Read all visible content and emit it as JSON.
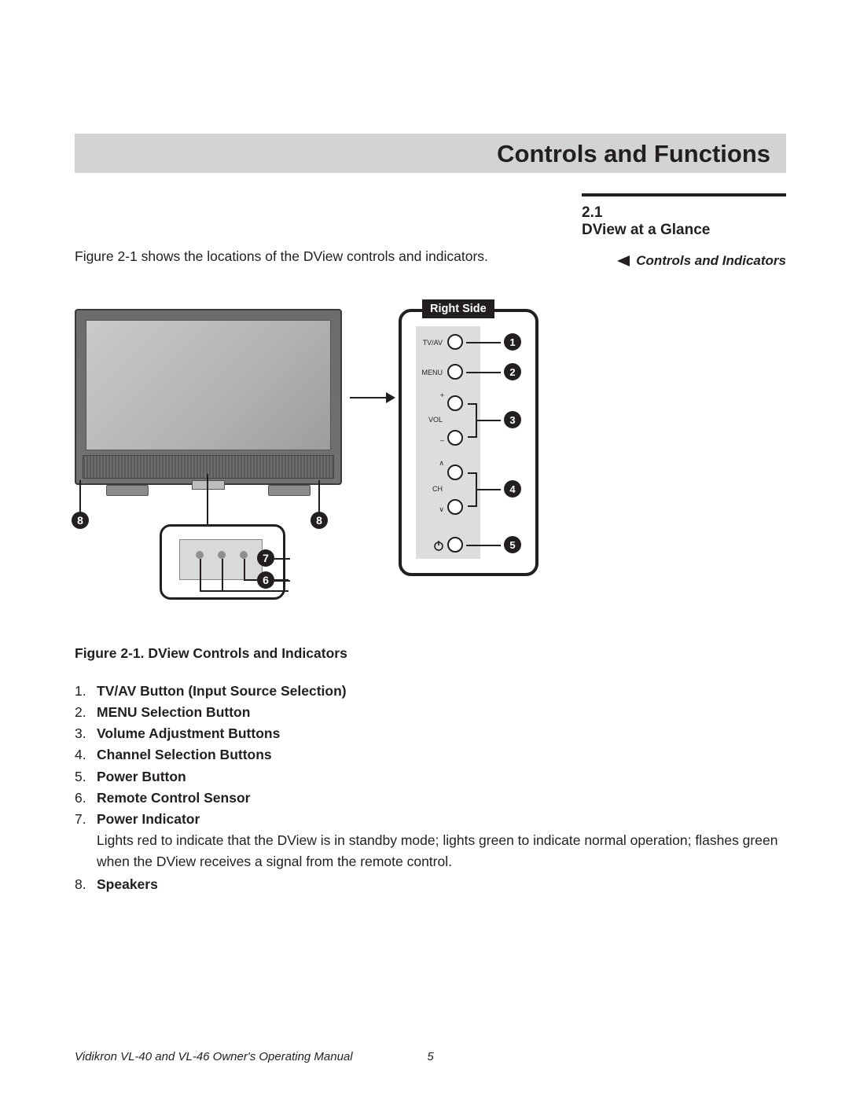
{
  "header": {
    "title": "Controls and Functions"
  },
  "section": {
    "number": "2.1",
    "title": "DView at a Glance"
  },
  "intro": "Figure 2-1 shows the locations of the DView controls and indicators.",
  "sidenote": "Controls and Indicators",
  "panel": {
    "tab": "Right Side",
    "labels": {
      "tvav": "TV/AV",
      "menu": "MENU",
      "vol": "VOL",
      "vol_plus": "+",
      "vol_minus": "–",
      "ch": "CH",
      "ch_up": "∧",
      "ch_down": "∨"
    },
    "callouts": {
      "n1": "1",
      "n2": "2",
      "n3": "3",
      "n4": "4",
      "n5": "5"
    }
  },
  "tv_callouts": {
    "n8": "8",
    "n7": "7",
    "n6": "6"
  },
  "caption": "Figure 2-1. DView Controls and Indicators",
  "list": [
    {
      "num": "1.",
      "label": "TV/AV Button (Input Source Selection)"
    },
    {
      "num": "2.",
      "label": "MENU Selection Button"
    },
    {
      "num": "3.",
      "label": "Volume Adjustment Buttons"
    },
    {
      "num": "4.",
      "label": "Channel Selection Buttons"
    },
    {
      "num": "5.",
      "label": "Power Button"
    },
    {
      "num": "6.",
      "label": "Remote Control Sensor"
    },
    {
      "num": "7.",
      "label": "Power Indicator",
      "desc": "Lights red to indicate that the DView is in standby mode; lights green to indicate normal operation; flashes green when the DView receives a signal from the remote control."
    },
    {
      "num": "8.",
      "label": "Speakers"
    }
  ],
  "footer": {
    "left": "Vidikron VL-40 and VL-46 Owner's Operating Manual",
    "page": "5"
  }
}
